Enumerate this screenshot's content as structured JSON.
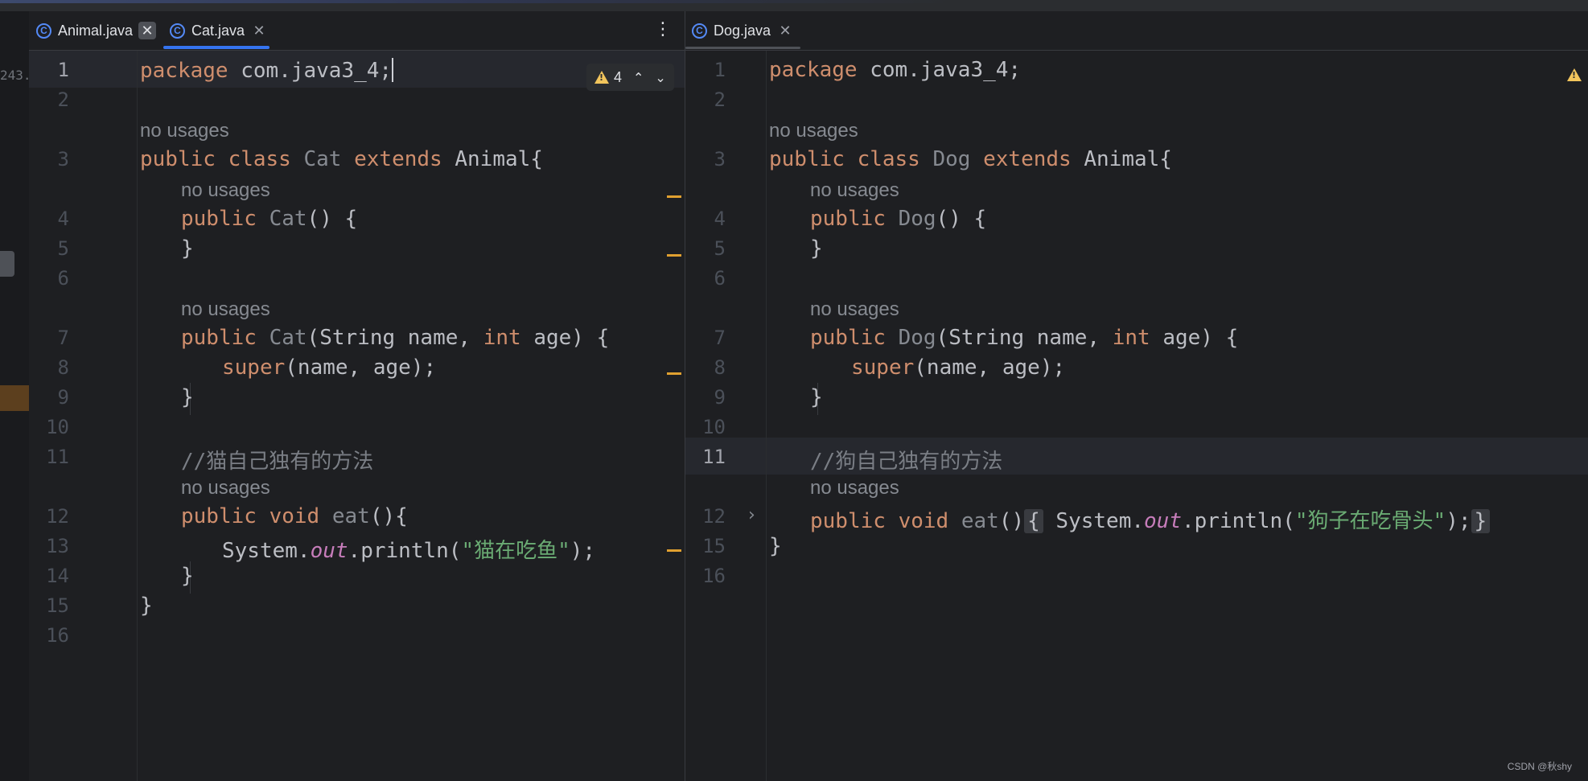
{
  "side": {
    "fragment": "243."
  },
  "left": {
    "tabs": [
      {
        "label": "Animal.java",
        "icon": "java-class-icon"
      },
      {
        "label": "Cat.java",
        "icon": "java-class-icon"
      }
    ],
    "inspection": {
      "count": "4",
      "icon": "warning-icon"
    },
    "lines": [
      {
        "n": "1",
        "code": "package com.java3_4;"
      },
      {
        "n": "2",
        "code": ""
      },
      {
        "hint": "no usages"
      },
      {
        "n": "3",
        "code": "public class Cat extends Animal{"
      },
      {
        "hint": "no usages"
      },
      {
        "n": "4",
        "code": "public Cat() {"
      },
      {
        "n": "5",
        "code": "}"
      },
      {
        "n": "6",
        "code": ""
      },
      {
        "hint": "no usages"
      },
      {
        "n": "7",
        "code": "public Cat(String name, int age) {"
      },
      {
        "n": "8",
        "code": "super(name, age);"
      },
      {
        "n": "9",
        "code": "}"
      },
      {
        "n": "10",
        "code": ""
      },
      {
        "n": "11",
        "code": "//猫自己独有的方法"
      },
      {
        "hint": "no usages"
      },
      {
        "n": "12",
        "code": "public void eat(){"
      },
      {
        "n": "13",
        "code": "System.out.println(\"猫在吃鱼\");"
      },
      {
        "n": "14",
        "code": "}"
      },
      {
        "n": "15",
        "code": "}"
      },
      {
        "n": "16",
        "code": ""
      }
    ]
  },
  "right": {
    "tabs": [
      {
        "label": "Dog.java",
        "icon": "java-class-icon"
      }
    ],
    "lines": [
      {
        "n": "1",
        "code": "package com.java3_4;"
      },
      {
        "n": "2",
        "code": ""
      },
      {
        "hint": "no usages"
      },
      {
        "n": "3",
        "code": "public class Dog extends Animal{"
      },
      {
        "hint": "no usages"
      },
      {
        "n": "4",
        "code": "public Dog() {"
      },
      {
        "n": "5",
        "code": "}"
      },
      {
        "n": "6",
        "code": ""
      },
      {
        "hint": "no usages"
      },
      {
        "n": "7",
        "code": "public Dog(String name, int age) {"
      },
      {
        "n": "8",
        "code": "super(name, age);"
      },
      {
        "n": "9",
        "code": "}"
      },
      {
        "n": "10",
        "code": ""
      },
      {
        "n": "11",
        "code": "//狗自己独有的方法"
      },
      {
        "hint": "no usages"
      },
      {
        "n": "12",
        "code": "public void eat() { System.out.println(\"狗子在吃骨头\"); }"
      },
      {
        "n": "15",
        "code": "}"
      },
      {
        "n": "16",
        "code": ""
      }
    ]
  },
  "watermark": "CSDN @秋shy",
  "colors": {
    "keyword": "#cf8e6d",
    "string": "#6aab73",
    "comment": "#7a7e85",
    "field": "#c77dbb",
    "accent": "#3574f0",
    "warning": "#f2c55c"
  }
}
